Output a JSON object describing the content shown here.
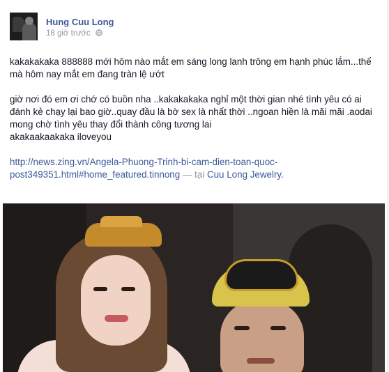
{
  "post": {
    "author": "Hung Cuu Long",
    "timestamp": "18 giờ trước",
    "privacy_icon": "globe-icon",
    "paragraph1": "kakakakaka 888888 mới hôm nào mắt em sáng long lanh trông em hạnh phúc lắm...thế mà hôm nay mắt em đang tràn lệ ướt",
    "paragraph2_line1": "giờ nơi đó em ơi chớ có buồn nha ..kakakakaka nghỉ một thời gian nhé tình yêu có ai đánh kẻ chạy lại bao giờ..quay đầu là bờ sex là nhất thời ..ngoan hiền là mãi mãi .aodai mong chờ tình yêu thay đổi thành công tương lai",
    "paragraph2_line2": "akakaakaakaka iloveyou",
    "link": "http://news.zing.vn/Angela-Phuong-Trinh-bi-cam-dien-toan-quoc-post349351.html#home_featured.tinnong",
    "location_sep": "— tại",
    "location": "Cuu Long Jewelry."
  }
}
